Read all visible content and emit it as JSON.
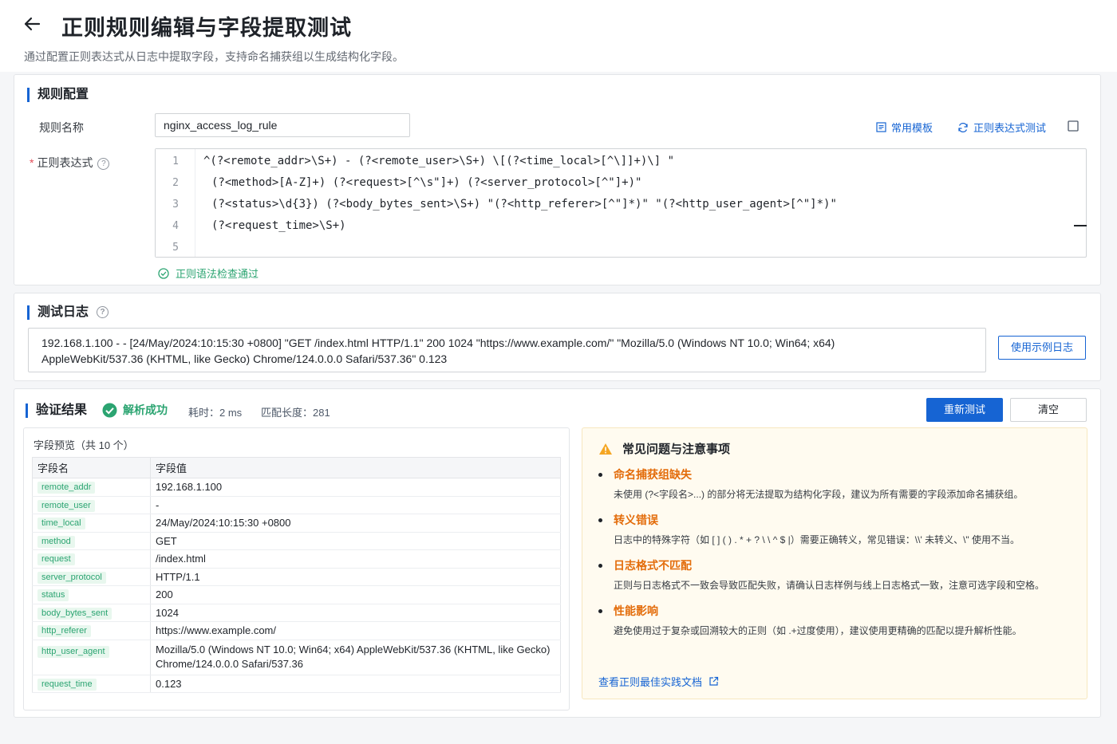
{
  "header": {
    "title": "正则规则编辑与字段提取测试",
    "subtitle": "通过配置正则表达式从日志中提取字段，支持命名捕获组以生成结构化字段。"
  },
  "config": {
    "section_title": "规则配置",
    "rule_name_label": "规则名称",
    "rule_name_value": "nginx_access_log_rule",
    "regex_label": "正则表达式",
    "template_btn": "常用模板",
    "regex_test_btn": "正则表达式测试",
    "lines": [
      "^(?<remote_addr>\\S+) - (?<remote_user>\\S+) \\[(?<time_local>[^\\]]+)\\] \"",
      "(?<method>[A-Z]+) (?<request>[^\\s\"]+) (?<server_protocol>[^\"]+)\"",
      "(?<status>\\d{3}) (?<body_bytes_sent>\\S+) \"(?<http_referer>[^\"]*)\" \"(?<http_user_agent>[^\"]*)\"",
      "(?<request_time>\\S+)",
      ""
    ],
    "line_numbers": [
      "1",
      "2",
      "3",
      "4",
      "5"
    ],
    "check_ok": "正则语法检查通过"
  },
  "testlog": {
    "section_title": "测试日志",
    "line1": "192.168.1.100 - - [24/May/2024:10:15:30 +0800] \"GET /index.html HTTP/1.1\" 200 1024 \"https://www.example.com/\" \"Mozilla/5.0 (Windows NT 10.0; Win64; x64)",
    "line2": "AppleWebKit/537.36 (KHTML, like Gecko) Chrome/124.0.0.0 Safari/537.36\"  0.123",
    "sample_btn": "使用示例日志"
  },
  "result": {
    "section_title": "验证结果",
    "status": "解析成功",
    "time_cost": "耗时：2 ms",
    "match_len": "匹配长度：281",
    "retest_btn": "重新测试",
    "clear_btn": "清空",
    "fields_title": "字段预览（共 10 个）",
    "col_name": "字段名",
    "col_value": "字段值",
    "rows": [
      {
        "name": "remote_addr",
        "value": "192.168.1.100"
      },
      {
        "name": "remote_user",
        "value": "-"
      },
      {
        "name": "time_local",
        "value": "24/May/2024:10:15:30 +0800"
      },
      {
        "name": "method",
        "value": "GET"
      },
      {
        "name": "request",
        "value": "/index.html"
      },
      {
        "name": "server_protocol",
        "value": "HTTP/1.1"
      },
      {
        "name": "status",
        "value": "200"
      },
      {
        "name": "body_bytes_sent",
        "value": "1024"
      },
      {
        "name": "http_referer",
        "value": "https://www.example.com/"
      },
      {
        "name": "http_user_agent",
        "value": "Mozilla/5.0 (Windows NT 10.0; Win64; x64) AppleWebKit/537.36 (KHTML, like Gecko) Chrome/124.0.0.0 Safari/537.36"
      },
      {
        "name": "request_time",
        "value": "0.123"
      }
    ]
  },
  "tips": {
    "title": "常见问题与注意事项",
    "items": [
      {
        "heading": "命名捕获组缺失",
        "desc": "未使用 (?<字段名>...) 的部分将无法提取为结构化字段，建议为所有需要的字段添加命名捕获组。"
      },
      {
        "heading": "转义错误",
        "desc": "日志中的特殊字符（如 [ ] ( ) . * + ? \\ \\ ^ $ |）需要正确转义，常见错误：\\\\' 未转义、\\\" 使用不当。"
      },
      {
        "heading": "日志格式不匹配",
        "desc": "正则与日志格式不一致会导致匹配失败，请确认日志样例与线上日志格式一致，注意可选字段和空格。"
      },
      {
        "heading": "性能影响",
        "desc": "避免使用过于复杂或回溯较大的正则（如 .+过度使用），建议使用更精确的匹配以提升解析性能。"
      }
    ],
    "doc_link": "查看正则最佳实践文档"
  },
  "colors": {
    "accent": "#1664d3",
    "success": "#2ba471",
    "warning": "#e36c0a"
  }
}
